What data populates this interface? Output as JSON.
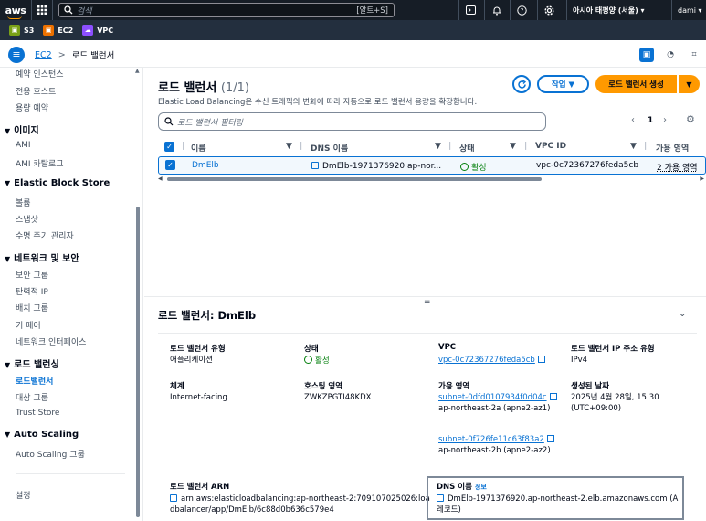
{
  "topbar": {
    "logo": "aws",
    "search_placeholder": "검색",
    "search_shortcut": "[알트+S]",
    "region": "아시아 태평양 (서울) ▾",
    "user": "dami ▾"
  },
  "favorites": [
    {
      "label": "S3",
      "color": "#7aa116"
    },
    {
      "label": "EC2",
      "color": "#ed7100"
    },
    {
      "label": "VPC",
      "color": "#8c4fff"
    }
  ],
  "breadcrumb": {
    "root": "EC2",
    "sep": ">",
    "current": "로드 밸런서"
  },
  "sidebar": {
    "items_top": [
      "예약 인스턴스",
      "전용 호스트",
      "용량 예약"
    ],
    "sections": [
      {
        "title": "이미지",
        "items": [
          "AMI",
          "AMI 카탈로그"
        ]
      },
      {
        "title": "Elastic Block Store",
        "items": [
          "볼륨",
          "스냅샷",
          "수명 주기 관리자"
        ]
      },
      {
        "title": "네트워크 및 보안",
        "items": [
          "보안 그룹",
          "탄력적 IP",
          "배치 그룹",
          "키 페어",
          "네트워크 인터페이스"
        ]
      },
      {
        "title": "로드 밸런싱",
        "items": [
          "로드밸런서",
          "대상 그룹",
          "Trust Store"
        ]
      },
      {
        "title": "Auto Scaling",
        "items": [
          "Auto Scaling 그룹"
        ]
      }
    ],
    "settings": "설정"
  },
  "main": {
    "title": "로드 밸런서",
    "count": "(1/1)",
    "description": "Elastic Load Balancing은 수신 트래픽의 변화에 따라 자동으로 로드 밸런서 용량을 확장합니다.",
    "actions_label": "작업 ▼",
    "create_label": "로드 밸런서 생성",
    "split_arrow": "▼",
    "filter_placeholder": "로드 밸런서 필터링",
    "page": "1",
    "columns": [
      "이름",
      "DNS 이름",
      "상태",
      "VPC ID",
      "가용 영역"
    ],
    "row": {
      "name": "DmElb",
      "dns": "DmElb-1971376920.ap-nor...",
      "state": "활성",
      "vpc": "vpc-0c72367276feda5cb",
      "az": "2 가용 영역"
    }
  },
  "details": {
    "title": "로드 밸런서: DmElb",
    "lb_type_label": "로드 밸런서 유형",
    "lb_type": "애플리케이션",
    "state_label": "상태",
    "state": "활성",
    "vpc_label": "VPC",
    "vpc": "vpc-0c72367276feda5cb",
    "ip_type_label": "로드 밸런서 IP 주소 유형",
    "ip_type": "IPv4",
    "scheme_label": "체계",
    "scheme": "Internet-facing",
    "hosted_zone_label": "호스팅 영역",
    "hosted_zone": "ZWKZPGTI48KDX",
    "az_label": "가용 영역",
    "subnet1": "subnet-0dfd0107934f0d04c",
    "subnet1_zone": "ap-northeast-2a (apne2-az1)",
    "subnet2": "subnet-0f726fe11c63f83a2",
    "subnet2_zone": "ap-northeast-2b (apne2-az2)",
    "created_label": "생성된 날짜",
    "created": "2025년 4월 28일, 15:30 (UTC+09:00)",
    "arn_label": "로드 밸런서 ARN",
    "arn": "arn:aws:elasticloadbalancing:ap-northeast-2:709107025026:loadbalancer/app/DmElb/6c88d0b636c579e4",
    "dns_label": "DNS 이름",
    "dns_info": "정보",
    "dns": "DmElb-1971376920.ap-northeast-2.elb.amazonaws.com (A 레코드)"
  }
}
